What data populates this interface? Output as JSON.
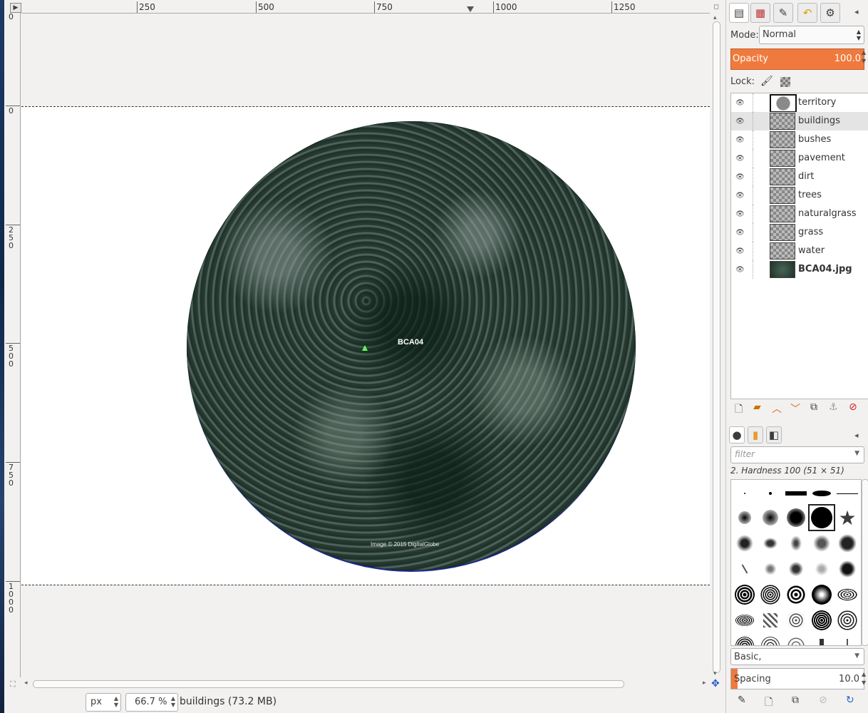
{
  "ruler": {
    "corner_glyph": "▶",
    "h_labels": [
      "250",
      "500",
      "750",
      "1000",
      "1250"
    ],
    "v_labels": [
      "0",
      "0",
      "250",
      "500",
      "750",
      "1000"
    ]
  },
  "canvas": {
    "map_label": "BCA04",
    "map_credit": "Image © 2015 DigitalGlobe"
  },
  "statusbar": {
    "unit": "px",
    "zoom": "66.7 %",
    "status": "buildings (73.2 MB)"
  },
  "layers_dock": {
    "mode_label": "Mode:",
    "mode_value": "Normal",
    "opacity_label": "Opacity",
    "opacity_value": "100.0",
    "lock_label": "Lock:",
    "layers": [
      {
        "name": "territory"
      },
      {
        "name": "buildings"
      },
      {
        "name": "bushes"
      },
      {
        "name": "pavement"
      },
      {
        "name": "dirt"
      },
      {
        "name": "trees"
      },
      {
        "name": "naturalgrass"
      },
      {
        "name": "grass"
      },
      {
        "name": "water"
      },
      {
        "name": "BCA04.jpg"
      }
    ],
    "selected_layer": "buildings"
  },
  "brushes_dock": {
    "filter_placeholder": "filter",
    "brush_name": "2. Hardness 100 (51 × 51)",
    "brush_set": "Basic,",
    "spacing_label": "Spacing",
    "spacing_value": "10.0"
  },
  "colors": {
    "accent": "#f07a3d",
    "guide": "#333333",
    "marker": "#5cff5c"
  },
  "icons": [
    "layers-tab-icon",
    "channels-tab-icon",
    "paths-tab-icon",
    "undo-history-tab-icon",
    "device-status-tab-icon",
    "eye-icon",
    "paint-lock-icon",
    "alpha-lock-icon",
    "new-layer-icon",
    "new-group-icon",
    "raise-layer-icon",
    "lower-layer-icon",
    "duplicate-layer-icon",
    "anchor-layer-icon",
    "delete-layer-icon",
    "brushes-tab-icon",
    "patterns-tab-icon",
    "gradients-tab-icon",
    "edit-brush-icon",
    "new-brush-icon",
    "duplicate-brush-icon",
    "delete-brush-icon",
    "refresh-brushes-icon"
  ]
}
